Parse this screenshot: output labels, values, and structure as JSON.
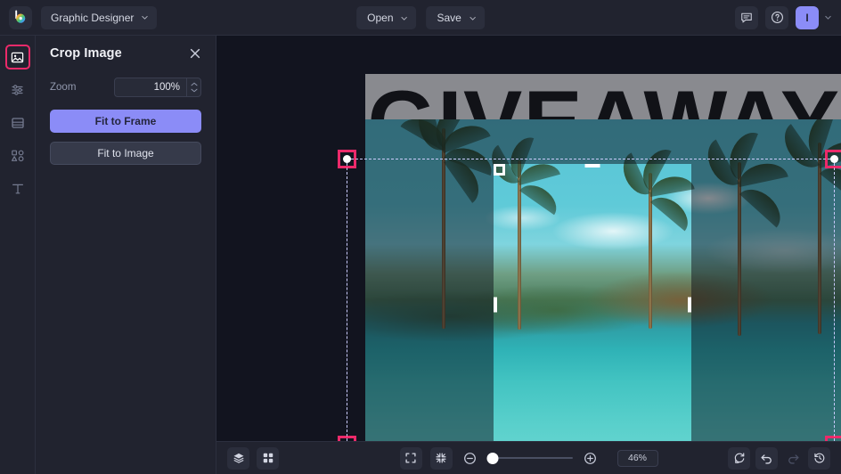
{
  "app": {
    "logo_icon": "colorwheel-b-logo",
    "workspace_label": "Graphic Designer"
  },
  "topbar": {
    "open_label": "Open",
    "save_label": "Save",
    "comments_icon": "comment-icon",
    "help_icon": "help-circle-icon",
    "avatar_initial": "I",
    "avatar_chevron_icon": "chevron-down-icon"
  },
  "rail": {
    "items": [
      {
        "name": "image",
        "icon": "image-icon",
        "active": true
      },
      {
        "name": "adjust",
        "icon": "sliders-icon",
        "active": false
      },
      {
        "name": "layout",
        "icon": "layout-icon",
        "active": false
      },
      {
        "name": "shapes",
        "icon": "shapes-icon",
        "active": false
      },
      {
        "name": "text",
        "icon": "text-t-icon",
        "active": false
      }
    ]
  },
  "panel": {
    "title": "Crop Image",
    "close_icon": "close-icon",
    "zoom_label": "Zoom",
    "zoom_value": "100%",
    "zoom_placeholder": "100%",
    "stepper_up_icon": "chevron-up-icon",
    "stepper_down_icon": "chevron-down-icon",
    "fit_to_frame_label": "Fit to Frame",
    "fit_to_image_label": "Fit to Image"
  },
  "canvas": {
    "design_text": "GIVEAWAY",
    "crop_handle_color": "#ec2a6a",
    "selection_color": "#8b8cf7",
    "crop_frame_color": "#ffffff"
  },
  "bottombar": {
    "layers_icon": "layers-icon",
    "grid_icon": "grid-icon",
    "fit_screen_icon": "expand-icon",
    "fit_selection_icon": "collapse-icon",
    "zoom_out_icon": "zoom-out-icon",
    "zoom_in_icon": "zoom-in-icon",
    "zoom_percent": "46%",
    "reset_icon": "reset-icon",
    "undo_icon": "undo-icon",
    "redo_icon": "redo-icon",
    "history_icon": "history-icon"
  }
}
